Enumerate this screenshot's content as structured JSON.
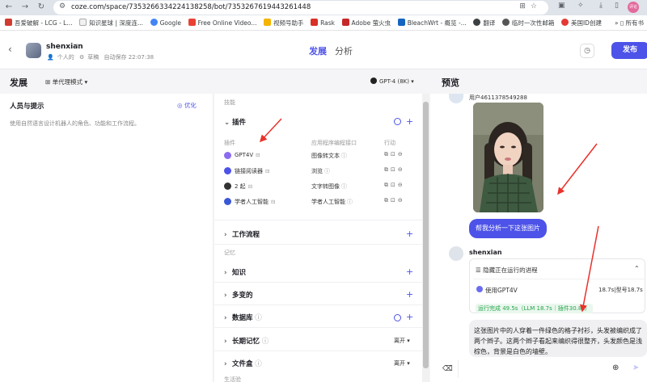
{
  "browser": {
    "url": "coze.com/space/7353266334224138258/bot/7353267619443261448",
    "bookmarks": [
      "吾爱破解 - LCG - L...",
      "知识星球 | 深度连...",
      "Google",
      "Free Online Video...",
      "视频号助手",
      "Rask",
      "Adobe 萤火虫",
      "BleachWrt - 概览 -...",
      "翻译",
      "临时一次性邮箱",
      "美国ID创建"
    ],
    "bookmarks_more": "所有书",
    "profile": "评论"
  },
  "header": {
    "bot_name": "shenxian",
    "owner": "个人的",
    "status": "草稿",
    "autosave": "自动保存 22:07:38",
    "tab_develop": "发展",
    "tab_analysis": "分析",
    "publish": "发布"
  },
  "develop": {
    "title": "发展",
    "mode": "单代理模式",
    "model": "GPT-4 (8K)"
  },
  "persona": {
    "title": "人员与提示",
    "optimize": "优化",
    "placeholder": "使用自然语言设计机器人的角色、功能和工作流程。"
  },
  "skills": {
    "section_skill": "技能",
    "plugins_title": "插件",
    "col_plugin": "插件",
    "col_api": "应用程序编程接口",
    "col_action": "行动",
    "plugins": [
      {
        "name": "GPT4V",
        "api": "图像转文本",
        "color": "#8a6cf0"
      },
      {
        "name": "链接阅读器",
        "api": "浏览",
        "color": "#4d53e8"
      },
      {
        "name": "2 起",
        "api": "文字转图像",
        "color": "#333333"
      },
      {
        "name": "学者人工智能",
        "api": "学者人工智能",
        "color": "#3a57d6"
      }
    ],
    "workflow": "工作流程",
    "section_memory": "记忆",
    "knowledge": "知识",
    "variable": "多变的",
    "database": "数据库",
    "longterm": "长期记忆",
    "longterm_value": "离开",
    "filebox": "文件盒",
    "filebox_value": "离开",
    "section_dialog": "生活验"
  },
  "preview": {
    "title": "预览",
    "user_name": "用户4611378549288",
    "question": "帮我分析一下这张图片",
    "bot_name": "shenxian",
    "process_title": "隐藏正在运行的进程",
    "process_use": "使用GPT4V",
    "process_time": "18.7s|型号18.7s",
    "process_done": "运行完成 49.5s（LLM 18.7s｜插件30.8s）",
    "answer": "这张图片中的人穿着一件绿色的格子衬衫，头发被编织成了两个辫子。这两个辫子看起来编织得很整齐，头发颜色是浅棕色，背景是白色的墙壁。"
  },
  "colors": {
    "accent": "#4d53e8",
    "arrow": "#e8322b",
    "success": "#27a44b"
  }
}
